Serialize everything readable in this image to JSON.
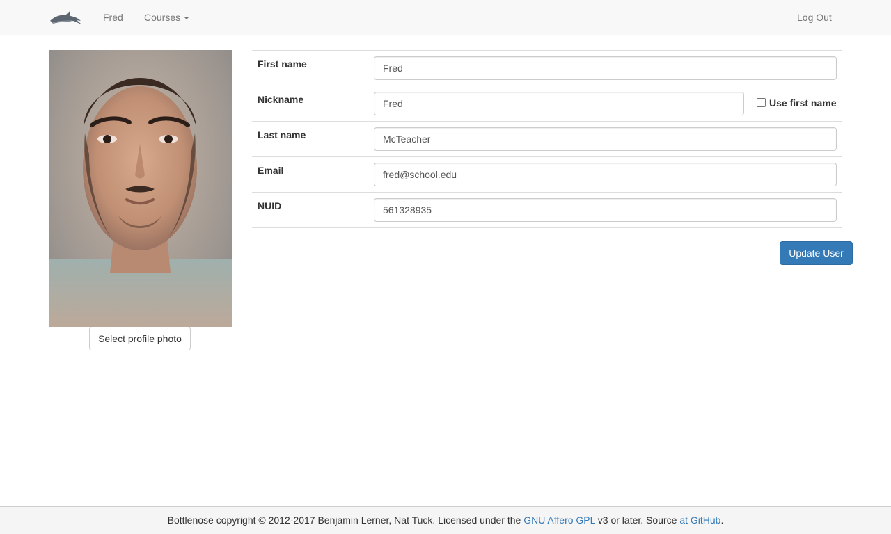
{
  "navbar": {
    "brand_icon": "dolphin-logo-icon",
    "user_label": "Fred",
    "courses_label": "Courses",
    "logout_label": "Log Out"
  },
  "profile": {
    "photo_icon": "profile-photo",
    "select_photo_label": "Select profile photo"
  },
  "form": {
    "first_name": {
      "label": "First name",
      "value": "Fred"
    },
    "nickname": {
      "label": "Nickname",
      "value": "Fred",
      "checkbox_label": "Use first name",
      "checkbox_checked": false
    },
    "last_name": {
      "label": "Last name",
      "value": "McTeacher"
    },
    "email": {
      "label": "Email",
      "value": "fred@school.edu"
    },
    "nuid": {
      "label": "NUID",
      "value": "561328935"
    },
    "submit_label": "Update User"
  },
  "footer": {
    "text_before": "Bottlenose copyright © 2012-2017 Benjamin Lerner, Nat Tuck. Licensed under the ",
    "license_link": "GNU Affero GPL",
    "text_middle": " v3 or later. Source ",
    "source_link": "at GitHub",
    "text_after": "."
  },
  "colors": {
    "primary": "#337ab7",
    "navbar_bg": "#f8f8f8",
    "footer_bg": "#f5f5f5"
  }
}
